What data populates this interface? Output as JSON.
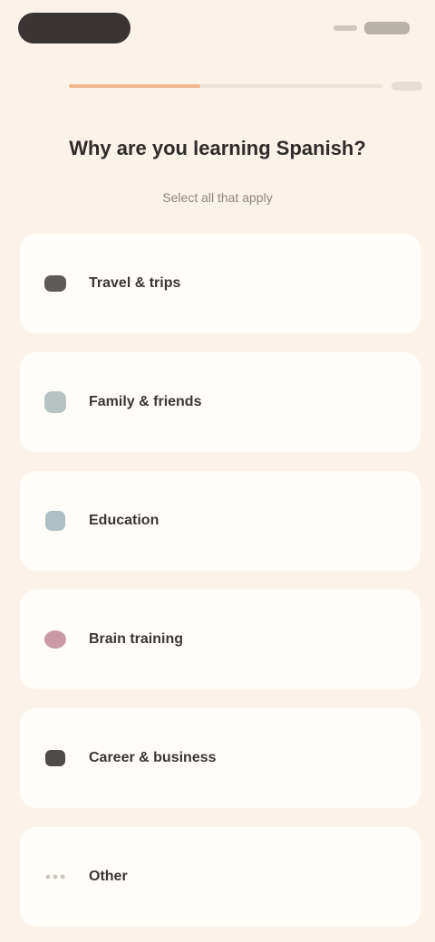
{
  "progress": {
    "value": 0.42
  },
  "header": {
    "title": "Why are you learning Spanish?",
    "subtitle": "Select all that apply"
  },
  "options": [
    {
      "label": "Travel & trips",
      "icon": "airplane-icon",
      "color": "#5f5b58"
    },
    {
      "label": "Family & friends",
      "icon": "people-icon",
      "color": "#b7c2c3"
    },
    {
      "label": "Education",
      "icon": "book-icon",
      "color": "#aebfc3"
    },
    {
      "label": "Brain training",
      "icon": "brain-icon",
      "color": "#c99aa6"
    },
    {
      "label": "Career & business",
      "icon": "briefcase-icon",
      "color": "#4e4b49"
    },
    {
      "label": "Other",
      "icon": "dots-icon",
      "color": "#cfc7bf"
    }
  ],
  "colors": {
    "background": "#fbf3ea",
    "progress_fill": "#f2b78a",
    "card": "#fffdfa"
  }
}
